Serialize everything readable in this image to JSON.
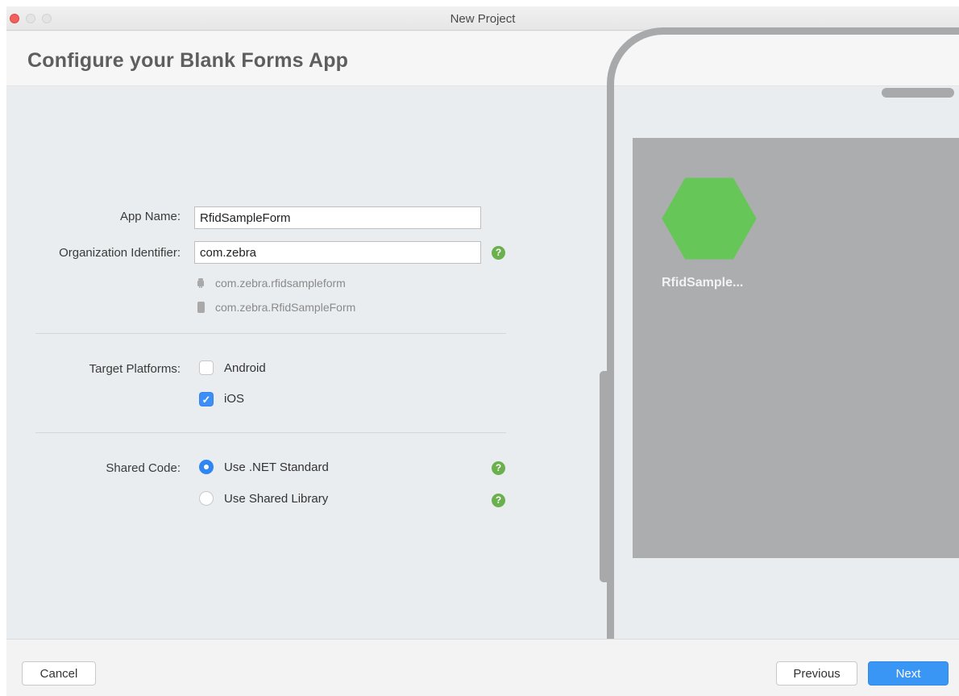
{
  "window": {
    "title": "New Project"
  },
  "header": {
    "title": "Configure your Blank Forms App"
  },
  "form": {
    "app_name_label": "App Name:",
    "app_name_value": "RfidSampleForm",
    "org_id_label": "Organization Identifier:",
    "org_id_value": "com.zebra",
    "android_package": "com.zebra.rfidsampleform",
    "ios_bundle": "com.zebra.RfidSampleForm",
    "target_platforms_label": "Target Platforms:",
    "platforms": [
      {
        "label": "Android",
        "checked": false
      },
      {
        "label": "iOS",
        "checked": true
      }
    ],
    "shared_code_label": "Shared Code:",
    "shared_code_options": [
      {
        "label": "Use .NET Standard",
        "selected": true
      },
      {
        "label": "Use Shared Library",
        "selected": false
      }
    ],
    "help_glyph": "?"
  },
  "preview": {
    "app_label": "RfidSample...",
    "icon_color": "#67c658"
  },
  "footer": {
    "cancel_label": "Cancel",
    "previous_label": "Previous",
    "next_label": "Next"
  },
  "colors": {
    "accent": "#3a96f4",
    "help": "#6ab04c",
    "close_button": "#f0605c"
  }
}
